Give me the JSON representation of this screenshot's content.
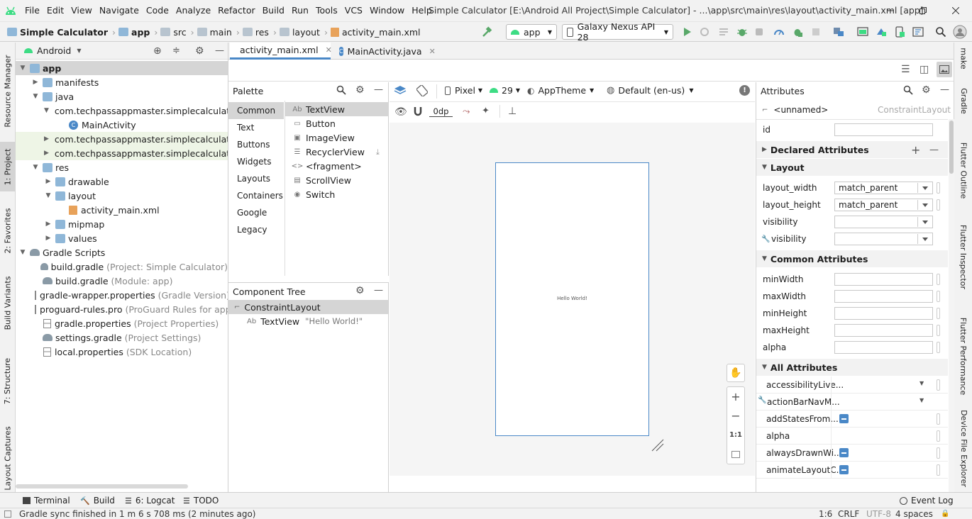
{
  "menubar": {
    "items": [
      "File",
      "Edit",
      "View",
      "Navigate",
      "Code",
      "Analyze",
      "Refactor",
      "Build",
      "Run",
      "Tools",
      "VCS",
      "Window",
      "Help"
    ],
    "title": "Simple Calculator [E:\\Android All Project\\Simple Calculator] - ...\\app\\src\\main\\res\\layout\\activity_main.xml [app]"
  },
  "navbar": {
    "crumbs": [
      "Simple Calculator",
      "app",
      "src",
      "main",
      "res",
      "layout",
      "activity_main.xml"
    ],
    "run_config": "app",
    "device": "Galaxy Nexus API 28"
  },
  "left_strip": [
    "Resource Manager",
    "1: Project",
    "2: Favorites",
    "Build Variants",
    "7: Structure",
    "Layout Captures"
  ],
  "right_strip": [
    "make",
    "Gradle",
    "Flutter Outline",
    "Flutter Inspector",
    "Flutter Performance",
    "Device File Explorer"
  ],
  "project": {
    "view": "Android",
    "tree": [
      {
        "label": "app",
        "muted": "",
        "indent": 0,
        "arrow": "▼",
        "icon": "folder",
        "sel": true,
        "bold": true
      },
      {
        "label": "manifests",
        "muted": "",
        "indent": 1,
        "arrow": "▶",
        "icon": "folder"
      },
      {
        "label": "java",
        "muted": "",
        "indent": 1,
        "arrow": "▼",
        "icon": "folder"
      },
      {
        "label": "com.techpassappmaster.simplecalculator",
        "muted": "",
        "indent": 2,
        "arrow": "▼",
        "icon": "folder"
      },
      {
        "label": "MainActivity",
        "muted": "",
        "indent": 3,
        "arrow": "",
        "icon": "class"
      },
      {
        "label": "com.techpassappmaster.simplecalculator (",
        "muted": "",
        "indent": 2,
        "arrow": "▶",
        "icon": "folder",
        "green": true
      },
      {
        "label": "com.techpassappmaster.simplecalculator (",
        "muted": "",
        "indent": 2,
        "arrow": "▶",
        "icon": "folder",
        "green": true
      },
      {
        "label": "res",
        "muted": "",
        "indent": 1,
        "arrow": "▼",
        "icon": "folder"
      },
      {
        "label": "drawable",
        "muted": "",
        "indent": 2,
        "arrow": "▶",
        "icon": "folder"
      },
      {
        "label": "layout",
        "muted": "",
        "indent": 2,
        "arrow": "▼",
        "icon": "folder"
      },
      {
        "label": "activity_main.xml",
        "muted": "",
        "indent": 3,
        "arrow": "",
        "icon": "xml"
      },
      {
        "label": "mipmap",
        "muted": "",
        "indent": 2,
        "arrow": "▶",
        "icon": "folder"
      },
      {
        "label": "values",
        "muted": "",
        "indent": 2,
        "arrow": "▶",
        "icon": "folder"
      },
      {
        "label": "Gradle Scripts",
        "muted": "",
        "indent": 0,
        "arrow": "▼",
        "icon": "gradle"
      },
      {
        "label": "build.gradle",
        "muted": " (Project: Simple Calculator)",
        "indent": 1,
        "arrow": "",
        "icon": "gradle"
      },
      {
        "label": "build.gradle",
        "muted": " (Module: app)",
        "indent": 1,
        "arrow": "",
        "icon": "gradle"
      },
      {
        "label": "gradle-wrapper.properties",
        "muted": " (Gradle Version)",
        "indent": 1,
        "arrow": "",
        "icon": "props"
      },
      {
        "label": "proguard-rules.pro",
        "muted": " (ProGuard Rules for app)",
        "indent": 1,
        "arrow": "",
        "icon": "file"
      },
      {
        "label": "gradle.properties",
        "muted": " (Project Properties)",
        "indent": 1,
        "arrow": "",
        "icon": "props"
      },
      {
        "label": "settings.gradle",
        "muted": " (Project Settings)",
        "indent": 1,
        "arrow": "",
        "icon": "gradle"
      },
      {
        "label": "local.properties",
        "muted": " (SDK Location)",
        "indent": 1,
        "arrow": "",
        "icon": "props"
      }
    ]
  },
  "editor_tabs": [
    "activity_main.xml",
    "MainActivity.java"
  ],
  "design_toolbar": {
    "device": "Pixel",
    "api": "29",
    "theme": "AppTheme",
    "locale": "Default (en-us)",
    "margin": "0dp"
  },
  "palette": {
    "title": "Palette",
    "categories": [
      "Common",
      "Text",
      "Buttons",
      "Widgets",
      "Layouts",
      "Containers",
      "Google",
      "Legacy"
    ],
    "items": [
      {
        "label": "TextView",
        "icon": "Ab"
      },
      {
        "label": "Button",
        "icon": "▭"
      },
      {
        "label": "ImageView",
        "icon": "▣"
      },
      {
        "label": "RecyclerView",
        "icon": "☰"
      },
      {
        "label": "<fragment>",
        "icon": "<>"
      },
      {
        "label": "ScrollView",
        "icon": "▤"
      },
      {
        "label": "Switch",
        "icon": "◉"
      }
    ]
  },
  "component_tree": {
    "title": "Component Tree",
    "root": "ConstraintLayout",
    "child_icon": "Ab",
    "child": "TextView",
    "child_value": "\"Hello World!\""
  },
  "canvas": {
    "hello": "Hello World!",
    "zoom_fit": "1:1"
  },
  "attributes": {
    "title": "Attributes",
    "component": "<unnamed>",
    "component_type": "ConstraintLayout",
    "id_label": "id",
    "declared": "Declared Attributes",
    "layout_section": "Layout",
    "layout_width_label": "layout_width",
    "layout_width": "match_parent",
    "layout_height_label": "layout_height",
    "layout_height": "match_parent",
    "visibility_label": "visibility",
    "tools_visibility_label": "visibility",
    "common": "Common Attributes",
    "common_rows": [
      "minWidth",
      "maxWidth",
      "minHeight",
      "maxHeight",
      "alpha"
    ],
    "all": "All Attributes",
    "all_rows": [
      {
        "label": "accessibilityLive...",
        "kind": "dd"
      },
      {
        "label": "actionBarNavM...",
        "kind": "dd",
        "tool": true
      },
      {
        "label": "addStatesFrom...",
        "kind": "cb"
      },
      {
        "label": "alpha",
        "kind": "pin"
      },
      {
        "label": "alwaysDrawnWi...",
        "kind": "cb"
      },
      {
        "label": "animateLayoutC...",
        "kind": "cb"
      }
    ]
  },
  "bottom_tabs": [
    "Terminal",
    "Build",
    "6: Logcat",
    "TODO"
  ],
  "event_log": "Event Log",
  "status": {
    "message": "Gradle sync finished in 1 m 6 s 708 ms (2 minutes ago)",
    "position": "1:6",
    "line_sep": "CRLF",
    "encoding": "UTF-8",
    "indent": "4 spaces"
  },
  "colors": {
    "accent": "#4a88c7",
    "android_green": "#3ddc84",
    "run_green": "#59a869"
  }
}
